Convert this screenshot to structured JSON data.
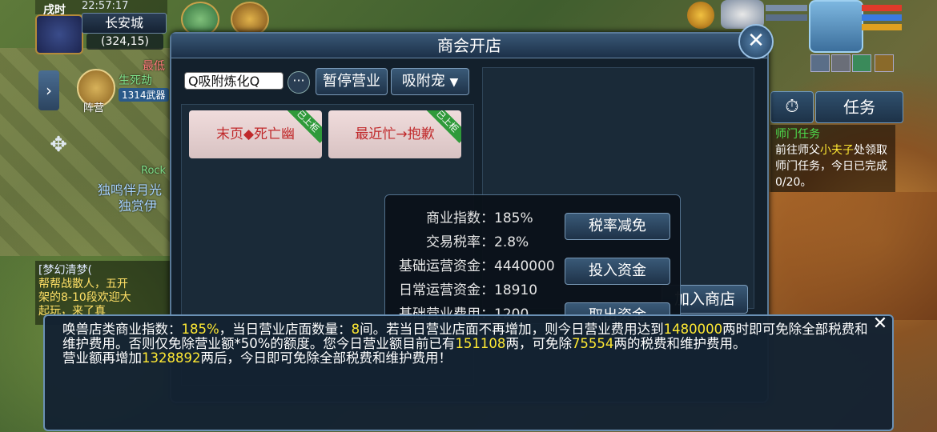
{
  "hud": {
    "time_period": "戌时",
    "clock": "22:57:17",
    "city": "长安城",
    "coords": "(324,15)",
    "camp_label": "阵营",
    "npc_labels": {
      "lowest": "最低",
      "life_death": "生死劫",
      "weapon": "1314武器",
      "rock": "Rock",
      "lone_wolf": "独鸣伴月光",
      "solo": "独赏伊"
    }
  },
  "chat": {
    "sender": "[梦幻清梦(",
    "lines": [
      "帮帮战散人，五开",
      "架的8-10段欢迎大",
      "起玩，来了真"
    ]
  },
  "task": {
    "button_label": "任务",
    "title": "师门任务",
    "text_before": "前往师父",
    "npc": "小夫子",
    "text_after": "处领取师门任务，今日已完成0/20。"
  },
  "dialog": {
    "title": "商会开店",
    "search_value": "Q吸附炼化Q",
    "more_label": "···",
    "pause_label": "暂停营业",
    "category_label": "吸附宠",
    "goods": [
      {
        "name": "末页◆死亡幽",
        "tag": "已上柜"
      },
      {
        "name": "最近忙→抱歉",
        "tag": "已上柜"
      }
    ],
    "join_shop_label": "加入商店"
  },
  "info": {
    "rows": [
      {
        "label": "商业指数：",
        "value": "185%"
      },
      {
        "label": "交易税率：",
        "value": "2.8%"
      },
      {
        "label": "基础运营资金：",
        "value": "4440000"
      },
      {
        "label": "日常运营资金：",
        "value": "18910"
      },
      {
        "label": "基础营业费用：",
        "value": "1200"
      }
    ],
    "buttons": [
      "税率减免",
      "投入资金",
      "取出资金"
    ]
  },
  "tooltip": {
    "p1_a": "唤兽店类商业指数：",
    "p1_index": "185%",
    "p1_b": "，当日营业店面数量：",
    "p1_count": "8",
    "p1_c": "间。若当日营业店面不再增加，则今日营业费用达到",
    "p1_threshold": "1480000",
    "p1_d": "两时即可免除全部税费和维护费用。否则仅免除营业额*50%的额度。您今日营业额目前已有",
    "p1_revenue": "151108",
    "p1_e": "两，可免除",
    "p1_exempt": "75554",
    "p1_f": "两的税费和维护费用。",
    "p2_a": "营业额再增加",
    "p2_amount": "1328892",
    "p2_b": "两后，今日即可免除全部税费和维护费用！",
    "close_label": "✕"
  }
}
